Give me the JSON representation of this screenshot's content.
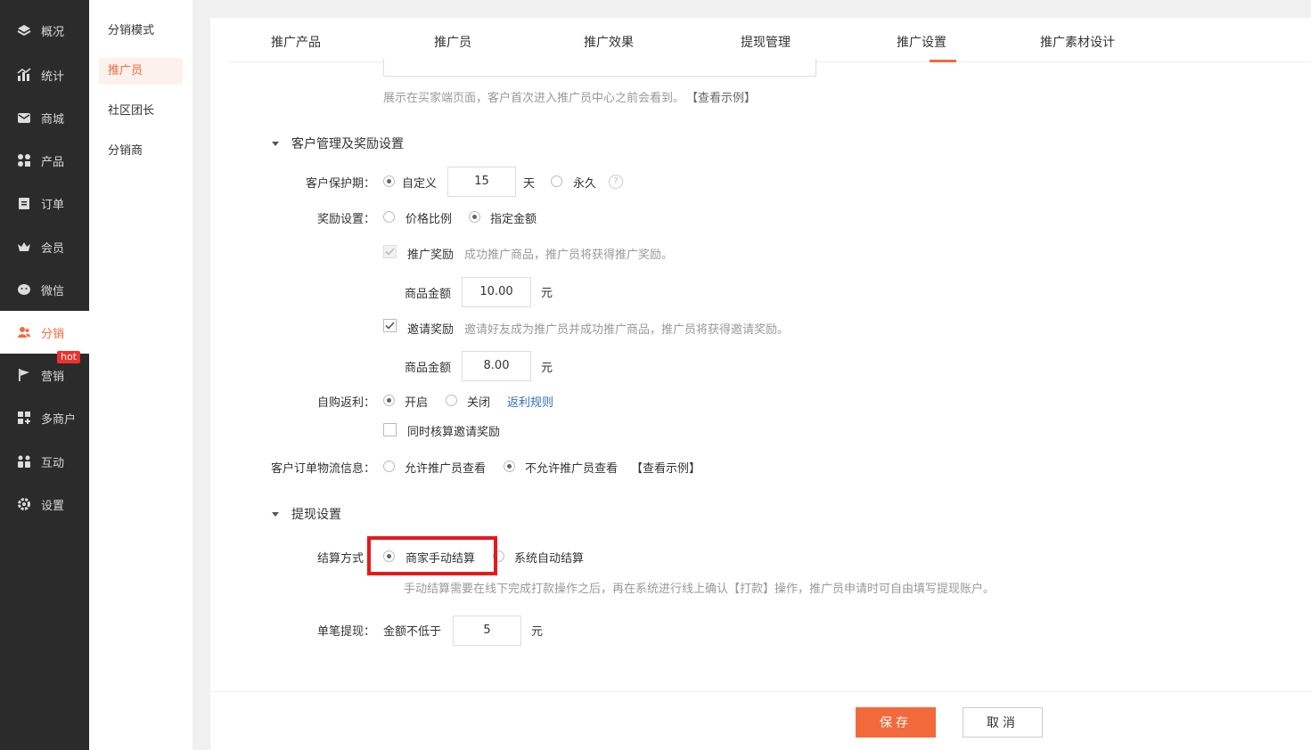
{
  "nav": {
    "items": [
      {
        "label": "概况",
        "icon": "layers-icon"
      },
      {
        "label": "统计",
        "icon": "chart-icon"
      },
      {
        "label": "商城",
        "icon": "mail-icon"
      },
      {
        "label": "产品",
        "icon": "grid-icon"
      },
      {
        "label": "订单",
        "icon": "clipboard-icon"
      },
      {
        "label": "会员",
        "icon": "crown-icon"
      },
      {
        "label": "微信",
        "icon": "wechat-icon"
      },
      {
        "label": "分销",
        "icon": "users-icon"
      },
      {
        "label": "营销",
        "icon": "flag-icon"
      },
      {
        "label": "多商户",
        "icon": "store-icon"
      },
      {
        "label": "互动",
        "icon": "people-icon"
      },
      {
        "label": "设置",
        "icon": "gear-icon"
      }
    ],
    "hot_badge": "hot",
    "accent": "#f26a3c"
  },
  "subnav": {
    "items": [
      "分销模式",
      "推广员",
      "社区团长",
      "分销商"
    ]
  },
  "tabs": [
    "推广产品",
    "推广员",
    "推广效果",
    "提现管理",
    "推广设置",
    "推广素材设计"
  ],
  "intro": {
    "hint": "展示在买家端页面，客户首次进入推广员中心之前会看到。",
    "example_link": "【查看示例】"
  },
  "customer_section": {
    "title": "客户管理及奖励设置",
    "protection": {
      "label": "客户保护期：",
      "opt_custom": "自定义",
      "days_value": "15",
      "days_unit": "天",
      "opt_forever": "永久",
      "help": "?"
    },
    "reward": {
      "label": "奖励设置：",
      "opt_ratio": "价格比例",
      "opt_fixed": "指定金额"
    },
    "promo_reward": {
      "label": "推广奖励",
      "desc": "成功推广商品，推广员将获得推广奖励。",
      "amount_label": "商品金额",
      "amount_value": "10.00",
      "unit": "元"
    },
    "invite_reward": {
      "label": "邀请奖励",
      "desc": "邀请好友成为推广员并成功推广商品，推广员将获得邀请奖励。",
      "amount_label": "商品金额",
      "amount_value": "8.00",
      "unit": "元"
    },
    "self_rebate": {
      "label": "自购返利：",
      "opt_on": "开启",
      "opt_off": "关闭",
      "rule_link": "返利规则",
      "also_check": "同时核算邀请奖励"
    },
    "logistics": {
      "label": "客户订单物流信息：",
      "opt_allow": "允许推广员查看",
      "opt_deny": "不允许推广员查看",
      "example_link": "【查看示例】"
    }
  },
  "withdraw_section": {
    "title": "提现设置",
    "settle": {
      "label": "结算方式",
      "opt_manual": "商家手动结算",
      "opt_auto": "系统自动结算",
      "hint": "手动结算需要在线下完成打款操作之后，再在系统进行线上确认【打款】操作，推广员申请时可自由填写提现账户。"
    },
    "single": {
      "label": "单笔提现：",
      "min_label": "金额不低于",
      "min_value": "5",
      "unit": "元"
    }
  },
  "footer": {
    "save": "保存",
    "cancel": "取消"
  }
}
